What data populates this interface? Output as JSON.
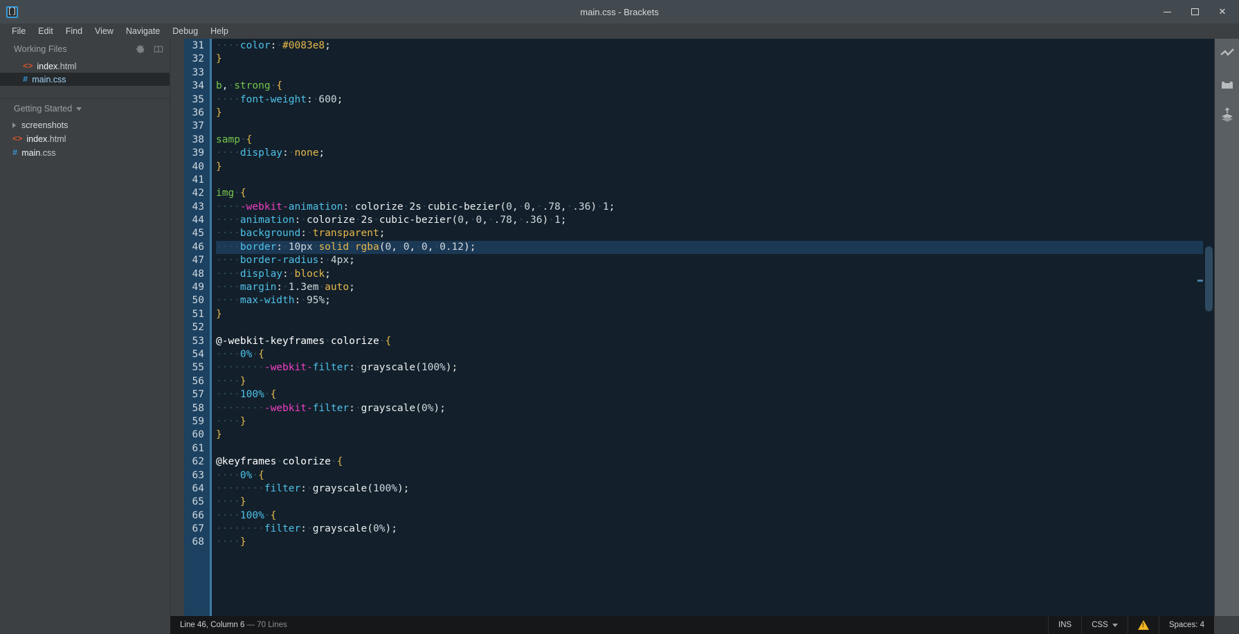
{
  "window": {
    "title": "main.css - Brackets",
    "logo_glyph": "[]",
    "minimize_label": "Minimize",
    "maximize_label": "Maximize",
    "close_label": "✕"
  },
  "menubar": {
    "items": [
      {
        "label": "File"
      },
      {
        "label": "Edit"
      },
      {
        "label": "Find"
      },
      {
        "label": "View"
      },
      {
        "label": "Navigate"
      },
      {
        "label": "Debug"
      },
      {
        "label": "Help"
      }
    ]
  },
  "sidebar": {
    "working_files": {
      "title": "Working Files",
      "gear_icon": "gear-icon",
      "split_icon": "split-view-icon",
      "files": [
        {
          "icon": "html-file-icon",
          "name": "index",
          "ext": ".html",
          "selected": false
        },
        {
          "icon": "css-file-icon",
          "name": "main",
          "ext": ".css",
          "selected": true
        }
      ]
    },
    "project": {
      "title": "Getting Started",
      "tree": [
        {
          "icon": "folder-collapsed-icon",
          "name": "screenshots",
          "ext": "",
          "type": "folder"
        },
        {
          "icon": "html-file-icon",
          "name": "index",
          "ext": ".html",
          "type": "file"
        },
        {
          "icon": "css-file-icon",
          "name": "main",
          "ext": ".css",
          "type": "file"
        }
      ]
    }
  },
  "editor": {
    "first_line": 31,
    "active_line": 46,
    "lines": [
      {
        "n": 31,
        "tokens": [
          {
            "t": "····",
            "c": "dot"
          },
          {
            "t": "color",
            "c": "prop"
          },
          {
            "t": ":",
            "c": "punc"
          },
          {
            "t": "·",
            "c": "dot"
          },
          {
            "t": "#0083e8",
            "c": "val"
          },
          {
            "t": ";",
            "c": "punc"
          }
        ]
      },
      {
        "n": 32,
        "tokens": [
          {
            "t": "}",
            "c": "brace"
          }
        ]
      },
      {
        "n": 33,
        "tokens": []
      },
      {
        "n": 34,
        "tokens": [
          {
            "t": "b",
            "c": "sel"
          },
          {
            "t": ",",
            "c": "punc"
          },
          {
            "t": "·",
            "c": "dot"
          },
          {
            "t": "strong",
            "c": "sel"
          },
          {
            "t": "·",
            "c": "dot"
          },
          {
            "t": "{",
            "c": "brace"
          }
        ]
      },
      {
        "n": 35,
        "tokens": [
          {
            "t": "····",
            "c": "dot"
          },
          {
            "t": "font-weight",
            "c": "prop"
          },
          {
            "t": ":",
            "c": "punc"
          },
          {
            "t": "·",
            "c": "dot"
          },
          {
            "t": "600",
            "c": "num"
          },
          {
            "t": ";",
            "c": "punc"
          }
        ]
      },
      {
        "n": 36,
        "tokens": [
          {
            "t": "}",
            "c": "brace"
          }
        ]
      },
      {
        "n": 37,
        "tokens": []
      },
      {
        "n": 38,
        "tokens": [
          {
            "t": "samp",
            "c": "sel"
          },
          {
            "t": "·",
            "c": "dot"
          },
          {
            "t": "{",
            "c": "brace"
          }
        ]
      },
      {
        "n": 39,
        "tokens": [
          {
            "t": "····",
            "c": "dot"
          },
          {
            "t": "display",
            "c": "prop"
          },
          {
            "t": ":",
            "c": "punc"
          },
          {
            "t": "·",
            "c": "dot"
          },
          {
            "t": "none",
            "c": "val"
          },
          {
            "t": ";",
            "c": "punc"
          }
        ]
      },
      {
        "n": 40,
        "tokens": [
          {
            "t": "}",
            "c": "brace"
          }
        ]
      },
      {
        "n": 41,
        "tokens": []
      },
      {
        "n": 42,
        "tokens": [
          {
            "t": "img",
            "c": "sel"
          },
          {
            "t": "·",
            "c": "dot"
          },
          {
            "t": "{",
            "c": "brace"
          }
        ]
      },
      {
        "n": 43,
        "tokens": [
          {
            "t": "····",
            "c": "dot"
          },
          {
            "t": "-webkit-",
            "c": "vendor"
          },
          {
            "t": "animation",
            "c": "prop"
          },
          {
            "t": ":",
            "c": "punc"
          },
          {
            "t": "·",
            "c": "dot"
          },
          {
            "t": "colorize",
            "c": "fn"
          },
          {
            "t": "·",
            "c": "dot"
          },
          {
            "t": "2s",
            "c": "fn"
          },
          {
            "t": "·",
            "c": "dot"
          },
          {
            "t": "cubic-bezier",
            "c": "fn"
          },
          {
            "t": "(",
            "c": "punc"
          },
          {
            "t": "0",
            "c": "num"
          },
          {
            "t": ",",
            "c": "punc"
          },
          {
            "t": "·",
            "c": "dot"
          },
          {
            "t": "0",
            "c": "num"
          },
          {
            "t": ",",
            "c": "punc"
          },
          {
            "t": "·",
            "c": "dot"
          },
          {
            "t": ".78",
            "c": "num"
          },
          {
            "t": ",",
            "c": "punc"
          },
          {
            "t": "·",
            "c": "dot"
          },
          {
            "t": ".36",
            "c": "num"
          },
          {
            "t": ")",
            "c": "punc"
          },
          {
            "t": "·",
            "c": "dot"
          },
          {
            "t": "1",
            "c": "num"
          },
          {
            "t": ";",
            "c": "punc"
          }
        ]
      },
      {
        "n": 44,
        "tokens": [
          {
            "t": "····",
            "c": "dot"
          },
          {
            "t": "animation",
            "c": "prop"
          },
          {
            "t": ":",
            "c": "punc"
          },
          {
            "t": "·",
            "c": "dot"
          },
          {
            "t": "colorize",
            "c": "fn"
          },
          {
            "t": "·",
            "c": "dot"
          },
          {
            "t": "2s",
            "c": "fn"
          },
          {
            "t": "·",
            "c": "dot"
          },
          {
            "t": "cubic-bezier",
            "c": "fn"
          },
          {
            "t": "(",
            "c": "punc"
          },
          {
            "t": "0",
            "c": "num"
          },
          {
            "t": ",",
            "c": "punc"
          },
          {
            "t": "·",
            "c": "dot"
          },
          {
            "t": "0",
            "c": "num"
          },
          {
            "t": ",",
            "c": "punc"
          },
          {
            "t": "·",
            "c": "dot"
          },
          {
            "t": ".78",
            "c": "num"
          },
          {
            "t": ",",
            "c": "punc"
          },
          {
            "t": "·",
            "c": "dot"
          },
          {
            "t": ".36",
            "c": "num"
          },
          {
            "t": ")",
            "c": "punc"
          },
          {
            "t": "·",
            "c": "dot"
          },
          {
            "t": "1",
            "c": "num"
          },
          {
            "t": ";",
            "c": "punc"
          }
        ]
      },
      {
        "n": 45,
        "tokens": [
          {
            "t": "····",
            "c": "dot"
          },
          {
            "t": "background",
            "c": "prop"
          },
          {
            "t": ":",
            "c": "punc"
          },
          {
            "t": "·",
            "c": "dot"
          },
          {
            "t": "transparent",
            "c": "val"
          },
          {
            "t": ";",
            "c": "punc"
          }
        ]
      },
      {
        "n": 46,
        "tokens": [
          {
            "t": "····",
            "c": "dot"
          },
          {
            "t": "border",
            "c": "prop"
          },
          {
            "t": ":",
            "c": "punc"
          },
          {
            "t": "·",
            "c": "dot"
          },
          {
            "t": "10px",
            "c": "num"
          },
          {
            "t": "·",
            "c": "dot"
          },
          {
            "t": "solid",
            "c": "val"
          },
          {
            "t": "·",
            "c": "dot"
          },
          {
            "t": "rgba",
            "c": "val"
          },
          {
            "t": "(",
            "c": "punc"
          },
          {
            "t": "0",
            "c": "num"
          },
          {
            "t": ",",
            "c": "punc"
          },
          {
            "t": "·",
            "c": "dot"
          },
          {
            "t": "0",
            "c": "num"
          },
          {
            "t": ",",
            "c": "punc"
          },
          {
            "t": "·",
            "c": "dot"
          },
          {
            "t": "0",
            "c": "num"
          },
          {
            "t": ",",
            "c": "punc"
          },
          {
            "t": "·",
            "c": "dot"
          },
          {
            "t": "0.12",
            "c": "num"
          },
          {
            "t": ")",
            "c": "punc"
          },
          {
            "t": ";",
            "c": "punc"
          }
        ]
      },
      {
        "n": 47,
        "tokens": [
          {
            "t": "····",
            "c": "dot"
          },
          {
            "t": "border-radius",
            "c": "prop"
          },
          {
            "t": ":",
            "c": "punc"
          },
          {
            "t": "·",
            "c": "dot"
          },
          {
            "t": "4px",
            "c": "num"
          },
          {
            "t": ";",
            "c": "punc"
          }
        ]
      },
      {
        "n": 48,
        "tokens": [
          {
            "t": "····",
            "c": "dot"
          },
          {
            "t": "display",
            "c": "prop"
          },
          {
            "t": ":",
            "c": "punc"
          },
          {
            "t": "·",
            "c": "dot"
          },
          {
            "t": "block",
            "c": "val"
          },
          {
            "t": ";",
            "c": "punc"
          }
        ]
      },
      {
        "n": 49,
        "tokens": [
          {
            "t": "····",
            "c": "dot"
          },
          {
            "t": "margin",
            "c": "prop"
          },
          {
            "t": ":",
            "c": "punc"
          },
          {
            "t": "·",
            "c": "dot"
          },
          {
            "t": "1.3em",
            "c": "num"
          },
          {
            "t": "·",
            "c": "dot"
          },
          {
            "t": "auto",
            "c": "val"
          },
          {
            "t": ";",
            "c": "punc"
          }
        ]
      },
      {
        "n": 50,
        "tokens": [
          {
            "t": "····",
            "c": "dot"
          },
          {
            "t": "max-width",
            "c": "prop"
          },
          {
            "t": ":",
            "c": "punc"
          },
          {
            "t": "·",
            "c": "dot"
          },
          {
            "t": "95%",
            "c": "num"
          },
          {
            "t": ";",
            "c": "punc"
          }
        ]
      },
      {
        "n": 51,
        "tokens": [
          {
            "t": "}",
            "c": "brace"
          }
        ]
      },
      {
        "n": 52,
        "tokens": []
      },
      {
        "n": 53,
        "tokens": [
          {
            "t": "@-webkit-keyframes",
            "c": "at"
          },
          {
            "t": "·",
            "c": "dot"
          },
          {
            "t": "colorize",
            "c": "at"
          },
          {
            "t": "·",
            "c": "dot"
          },
          {
            "t": "{",
            "c": "brace"
          }
        ]
      },
      {
        "n": 54,
        "tokens": [
          {
            "t": "····",
            "c": "dot"
          },
          {
            "t": "0%",
            "c": "prop"
          },
          {
            "t": "·",
            "c": "dot"
          },
          {
            "t": "{",
            "c": "brace"
          }
        ]
      },
      {
        "n": 55,
        "tokens": [
          {
            "t": "········",
            "c": "dot"
          },
          {
            "t": "-webkit-",
            "c": "vendor"
          },
          {
            "t": "filter",
            "c": "prop"
          },
          {
            "t": ":",
            "c": "punc"
          },
          {
            "t": "·",
            "c": "dot"
          },
          {
            "t": "grayscale",
            "c": "fn"
          },
          {
            "t": "(",
            "c": "punc"
          },
          {
            "t": "100%",
            "c": "num"
          },
          {
            "t": ")",
            "c": "punc"
          },
          {
            "t": ";",
            "c": "punc"
          }
        ]
      },
      {
        "n": 56,
        "tokens": [
          {
            "t": "····",
            "c": "dot"
          },
          {
            "t": "}",
            "c": "brace"
          }
        ]
      },
      {
        "n": 57,
        "tokens": [
          {
            "t": "····",
            "c": "dot"
          },
          {
            "t": "100%",
            "c": "prop"
          },
          {
            "t": "·",
            "c": "dot"
          },
          {
            "t": "{",
            "c": "brace"
          }
        ]
      },
      {
        "n": 58,
        "tokens": [
          {
            "t": "········",
            "c": "dot"
          },
          {
            "t": "-webkit-",
            "c": "vendor"
          },
          {
            "t": "filter",
            "c": "prop"
          },
          {
            "t": ":",
            "c": "punc"
          },
          {
            "t": "·",
            "c": "dot"
          },
          {
            "t": "grayscale",
            "c": "fn"
          },
          {
            "t": "(",
            "c": "punc"
          },
          {
            "t": "0%",
            "c": "num"
          },
          {
            "t": ")",
            "c": "punc"
          },
          {
            "t": ";",
            "c": "punc"
          }
        ]
      },
      {
        "n": 59,
        "tokens": [
          {
            "t": "····",
            "c": "dot"
          },
          {
            "t": "}",
            "c": "brace"
          }
        ]
      },
      {
        "n": 60,
        "tokens": [
          {
            "t": "}",
            "c": "brace"
          }
        ]
      },
      {
        "n": 61,
        "tokens": []
      },
      {
        "n": 62,
        "tokens": [
          {
            "t": "@keyframes",
            "c": "at"
          },
          {
            "t": "·",
            "c": "dot"
          },
          {
            "t": "colorize",
            "c": "at"
          },
          {
            "t": "·",
            "c": "dot"
          },
          {
            "t": "{",
            "c": "brace"
          }
        ]
      },
      {
        "n": 63,
        "tokens": [
          {
            "t": "····",
            "c": "dot"
          },
          {
            "t": "0%",
            "c": "prop"
          },
          {
            "t": "·",
            "c": "dot"
          },
          {
            "t": "{",
            "c": "brace"
          }
        ]
      },
      {
        "n": 64,
        "tokens": [
          {
            "t": "········",
            "c": "dot"
          },
          {
            "t": "filter",
            "c": "prop"
          },
          {
            "t": ":",
            "c": "punc"
          },
          {
            "t": "·",
            "c": "dot"
          },
          {
            "t": "grayscale",
            "c": "fn"
          },
          {
            "t": "(",
            "c": "punc"
          },
          {
            "t": "100%",
            "c": "num"
          },
          {
            "t": ")",
            "c": "punc"
          },
          {
            "t": ";",
            "c": "punc"
          }
        ]
      },
      {
        "n": 65,
        "tokens": [
          {
            "t": "····",
            "c": "dot"
          },
          {
            "t": "}",
            "c": "brace"
          }
        ]
      },
      {
        "n": 66,
        "tokens": [
          {
            "t": "····",
            "c": "dot"
          },
          {
            "t": "100%",
            "c": "prop"
          },
          {
            "t": "·",
            "c": "dot"
          },
          {
            "t": "{",
            "c": "brace"
          }
        ]
      },
      {
        "n": 67,
        "tokens": [
          {
            "t": "········",
            "c": "dot"
          },
          {
            "t": "filter",
            "c": "prop"
          },
          {
            "t": ":",
            "c": "punc"
          },
          {
            "t": "·",
            "c": "dot"
          },
          {
            "t": "grayscale",
            "c": "fn"
          },
          {
            "t": "(",
            "c": "punc"
          },
          {
            "t": "0%",
            "c": "num"
          },
          {
            "t": ")",
            "c": "punc"
          },
          {
            "t": ";",
            "c": "punc"
          }
        ]
      },
      {
        "n": 68,
        "tokens": [
          {
            "t": "····",
            "c": "dot"
          },
          {
            "t": "}",
            "c": "brace"
          }
        ]
      }
    ]
  },
  "right_toolbar": {
    "items": [
      {
        "icon": "live-preview-icon",
        "label": "Live Preview"
      },
      {
        "icon": "extension-manager-icon",
        "label": "Extension Manager"
      },
      {
        "icon": "git-icon",
        "label": "Git"
      }
    ]
  },
  "statusbar": {
    "cursor_main": "Line 46, Column 6",
    "cursor_sep": " — ",
    "cursor_lines": "70 Lines",
    "insert_mode": "INS",
    "language": "CSS",
    "warning_icon": "warning-triangle-icon",
    "indent": "Spaces: 4"
  },
  "colors": {
    "accent_blue": "#3a9ad9",
    "gutter_blue": "#1c4161",
    "editor_bg": "#13202b",
    "chrome_bg": "#3c4043",
    "warning": "#f0b323"
  }
}
